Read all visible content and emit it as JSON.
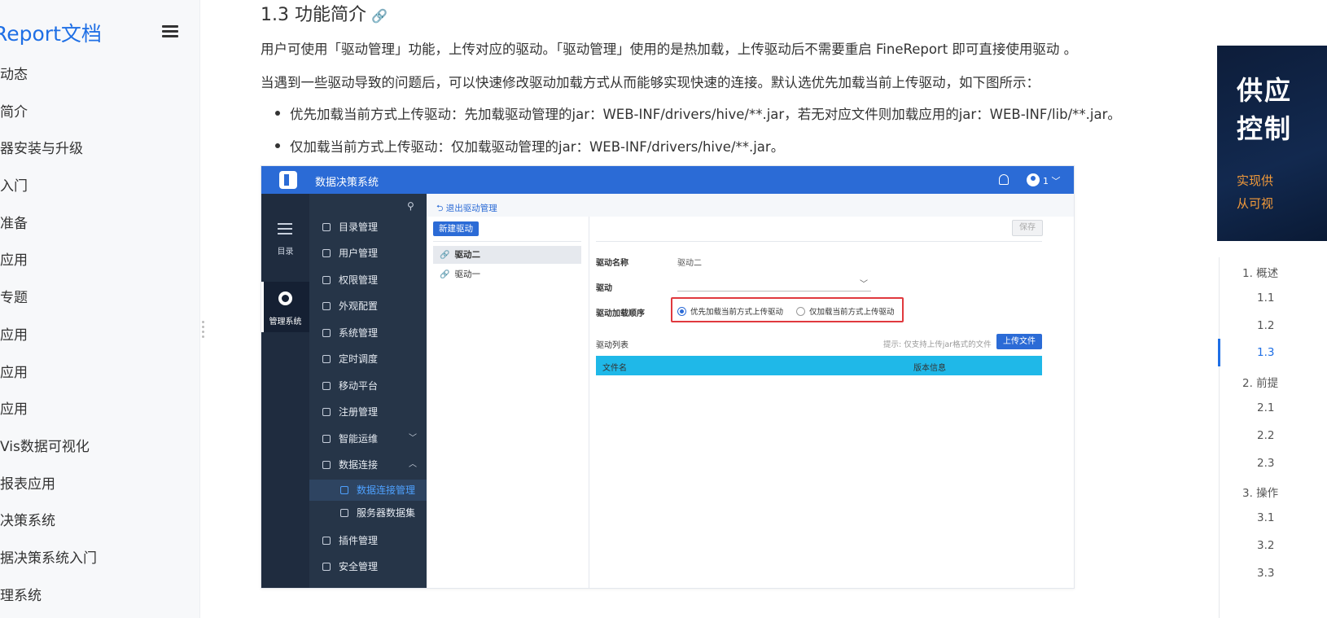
{
  "doc_sidebar": {
    "title": "Report文档",
    "nav_items": [
      "动态",
      "简介",
      "器安装与升级",
      "入门",
      "准备",
      "应用",
      "专题",
      "应用",
      "应用",
      "应用",
      "Vis数据可视化",
      "报表应用",
      "决策系统",
      "据决策系统入门",
      "理系统"
    ]
  },
  "content": {
    "heading": "1.3 功能简介",
    "paragraph1": "用户可使用「驱动管理」功能，上传对应的驱动。「驱动管理」使用的是热加载，上传驱动后不需要重启 FineReport 即可直接使用驱动 。",
    "paragraph2": "当遇到一些驱动导致的问题后，可以快速修改驱动加载方式从而能够实现快速的连接。默认选优先加载当前上传驱动，如下图所示：",
    "bullets": [
      "优先加载当前方式上传驱动：先加载驱动管理的jar：WEB-INF/drivers/hive/**.jar，若无对应文件则加载应用的jar：WEB-INF/lib/**.jar。",
      "仅加载当前方式上传驱动：仅加载驱动管理的jar：WEB-INF/drivers/hive/**.jar。"
    ]
  },
  "screenshot": {
    "app_name": "数据决策系统",
    "user_label": "1",
    "rail": {
      "catalog": "目录",
      "admin": "管理系统"
    },
    "menu": [
      {
        "label": "目录管理",
        "icon": "catalog-icon"
      },
      {
        "label": "用户管理",
        "icon": "user-icon"
      },
      {
        "label": "权限管理",
        "icon": "shield-icon"
      },
      {
        "label": "外观配置",
        "icon": "paint-icon"
      },
      {
        "label": "系统管理",
        "icon": "gear-icon"
      },
      {
        "label": "定时调度",
        "icon": "timer-icon"
      },
      {
        "label": "移动平台",
        "icon": "mobile-icon"
      },
      {
        "label": "注册管理",
        "icon": "register-icon"
      },
      {
        "label": "智能运维",
        "icon": "ops-icon",
        "chevron": "﹀"
      },
      {
        "label": "数据连接",
        "icon": "link-icon",
        "chevron": "︿"
      },
      {
        "label": "数据连接管理",
        "icon": "connection-icon",
        "sub": true,
        "active": true
      },
      {
        "label": "服务器数据集",
        "icon": "dataset-icon",
        "sub": true
      },
      {
        "label": "插件管理",
        "icon": "plugin-icon"
      },
      {
        "label": "安全管理",
        "icon": "security-icon"
      }
    ],
    "back_link": "退出驱动管理",
    "new_driver": "新建驱动",
    "drivers": [
      "驱动二",
      "驱动一"
    ],
    "save": "保存",
    "field_name_label": "驱动名称",
    "field_name_value": "驱动二",
    "field_driver_label": "驱动",
    "field_order_label": "驱动加载顺序",
    "order_options": [
      "优先加载当前方式上传驱动",
      "仅加载当前方式上传驱动"
    ],
    "order_selected": 0,
    "list_label": "驱动列表",
    "hint": "提示: 仅支持上传jar格式的文件",
    "upload": "上传文件",
    "table_columns": [
      "文件名",
      "版本信息"
    ]
  },
  "ad": {
    "line1": "供应",
    "line2": "控制",
    "sub1": "实现供",
    "sub2": "从可视"
  },
  "toc": [
    {
      "label": "1. 概述",
      "level": 1
    },
    {
      "label": "1.1",
      "level": 2
    },
    {
      "label": "1.2",
      "level": 2
    },
    {
      "label": "1.3",
      "level": 2,
      "active": true
    },
    {
      "label": "2. 前提",
      "level": 1
    },
    {
      "label": "2.1",
      "level": 2
    },
    {
      "label": "2.2",
      "level": 2
    },
    {
      "label": "2.3",
      "level": 2
    },
    {
      "label": "3. 操作",
      "level": 1
    },
    {
      "label": "3.1",
      "level": 2
    },
    {
      "label": "3.2",
      "level": 2
    },
    {
      "label": "3.3",
      "level": 2
    }
  ],
  "colors": {
    "accent": "#1f6fe5",
    "app_blue": "#2b6bd6",
    "highlight_red": "#e0393e",
    "table_header": "#1fb8e8"
  }
}
